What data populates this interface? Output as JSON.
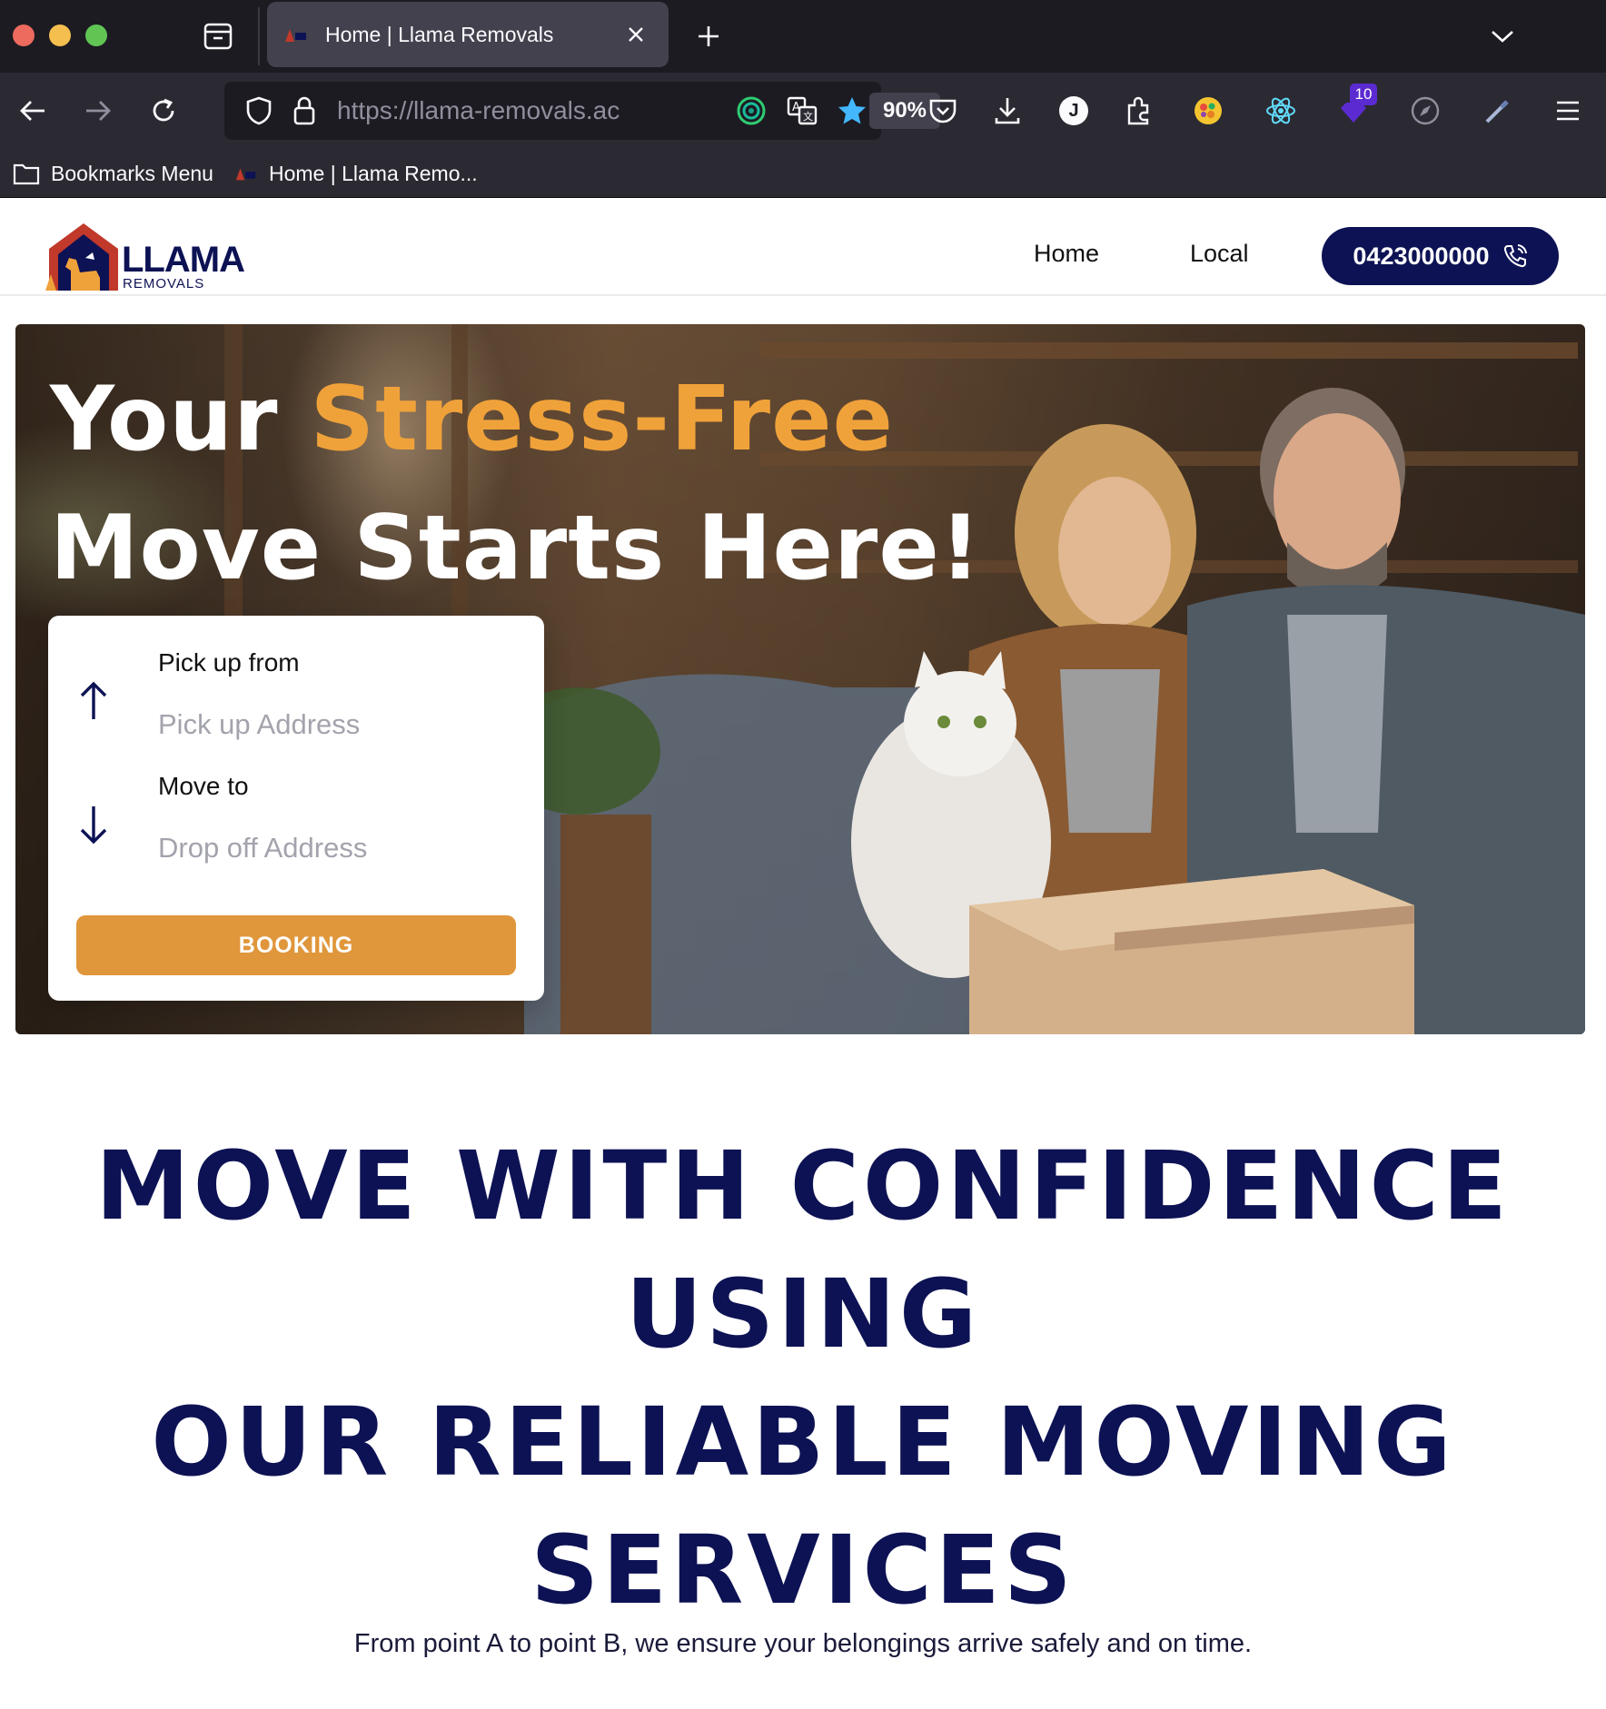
{
  "browser": {
    "tab_title": "Home | Llama Removals",
    "url": "https://llama-removals.ac",
    "zoom": "90%",
    "extension_badge": "10",
    "profile_initial": "J",
    "bookmarks": [
      {
        "label": "Bookmarks Menu"
      },
      {
        "label": "Home | Llama Remo..."
      }
    ]
  },
  "site": {
    "logo_word": "LLAMA",
    "logo_sub": "REMOVALS",
    "nav": [
      {
        "label": "Home"
      },
      {
        "label": "Local"
      }
    ],
    "phone": "0423000000"
  },
  "hero": {
    "title_line1_white": "Your ",
    "title_line1_accent": "Stress-Free",
    "title_line2": "Move Starts Here!",
    "form": {
      "pickup_label": "Pick up from",
      "pickup_placeholder": "Pick up Address",
      "dropoff_label": "Move to",
      "dropoff_placeholder": "Drop off Address",
      "button": "BOOKING"
    }
  },
  "section": {
    "heading_lines": [
      "MOVE WITH CONFIDENCE",
      "USING",
      "OUR RELIABLE MOVING",
      "SERVICES"
    ],
    "subline": "From point A to point B, we ensure your belongings arrive safely and on time."
  },
  "colors": {
    "brand_navy": "#0d1254",
    "accent_orange": "#f0a23a",
    "button_orange": "#e0963b"
  }
}
